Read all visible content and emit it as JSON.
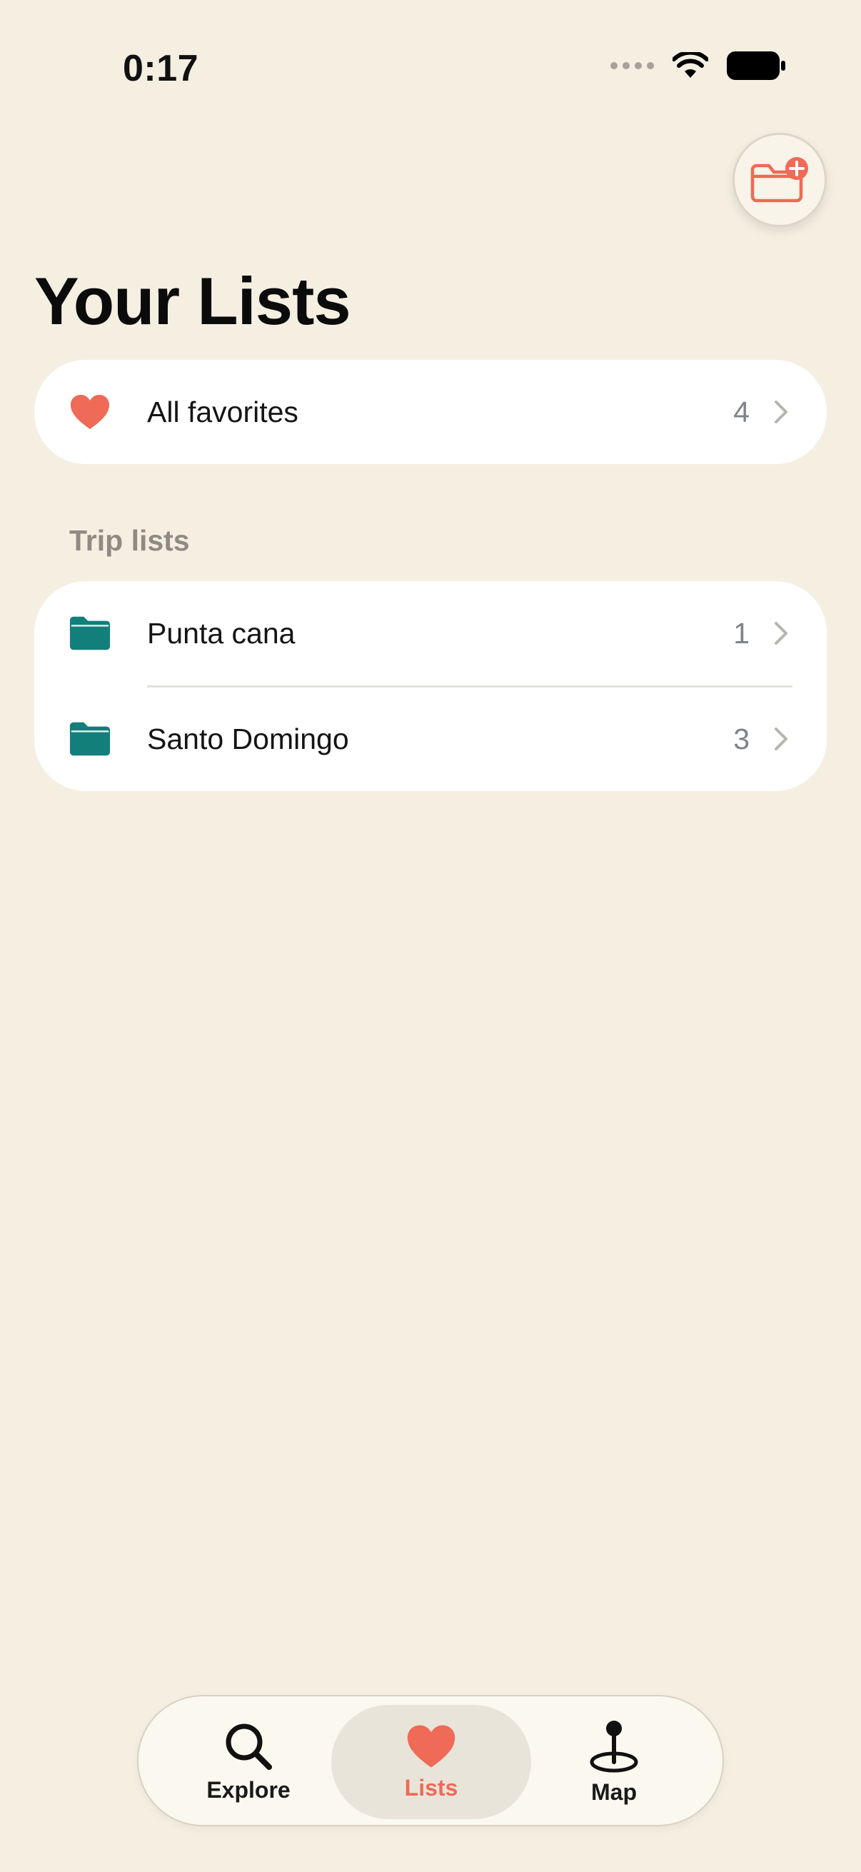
{
  "status_bar": {
    "time": "0:17"
  },
  "header": {
    "new_list_icon": "folder-plus-icon",
    "title": "Your Lists"
  },
  "favorites": {
    "icon": "heart-icon",
    "label": "All favorites",
    "count": "4"
  },
  "trip_lists": {
    "section_label": "Trip lists",
    "items": [
      {
        "icon": "folder-icon",
        "label": "Punta cana",
        "count": "1"
      },
      {
        "icon": "folder-icon",
        "label": "Santo Domingo",
        "count": "3"
      }
    ]
  },
  "tab_bar": {
    "tabs": [
      {
        "icon": "search-icon",
        "label": "Explore",
        "selected": false
      },
      {
        "icon": "heart-icon",
        "label": "Lists",
        "selected": true
      },
      {
        "icon": "map-pin-icon",
        "label": "Map",
        "selected": false
      }
    ]
  },
  "colors": {
    "background": "#f5efe2",
    "accent": "#ef6a57",
    "folder": "#137f7b",
    "card": "#ffffff"
  }
}
